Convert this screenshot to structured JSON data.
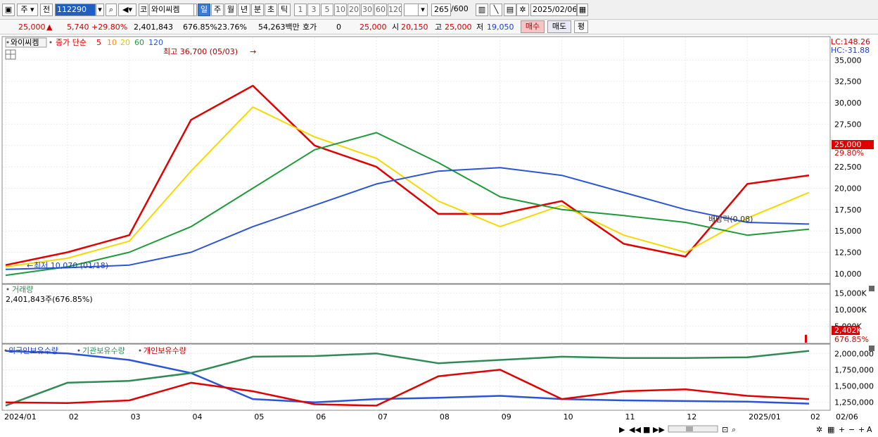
{
  "toolbar": {
    "market_combo": "주",
    "prev_label": "전",
    "code": "112290",
    "name_prefix": "코",
    "stock_name": "와이씨켐",
    "periods": [
      "일",
      "주",
      "월",
      "년",
      "분",
      "초",
      "틱"
    ],
    "intervals": [
      "1",
      "3",
      "5",
      "10",
      "20",
      "30",
      "60",
      "120"
    ],
    "count": "265",
    "count_max": "/600",
    "date": "2025/02/06"
  },
  "quote": {
    "price": "25,000",
    "change": "5,740",
    "change_pct": "+29.80%",
    "volume": "2,401,843",
    "volume_ratio": "676.85%",
    "turnover": "23.76%",
    "amount": "54,263백만",
    "hoga_label": "호가",
    "hoga_value": "0",
    "hoga_price": "25,000",
    "open_label": "시",
    "open": "20,150",
    "high_label": "고",
    "high": "25,000",
    "low_label": "저",
    "low": "19,050",
    "buy_button": "매수",
    "sell_button": "매도",
    "eval_button": "평"
  },
  "price_panel": {
    "stock_tag": "와이씨켐",
    "legend_main": "종가 단순",
    "ma_labels": [
      "5",
      "10",
      "20",
      "60",
      "120"
    ],
    "ma_colors": [
      "#e00000",
      "#ff8c1a",
      "#f5d800",
      "#1f9a3a",
      "#2b55d6"
    ],
    "lc": "LC:148.26",
    "hc": "HC:-31.88",
    "high_annotation": "최고 36,700 (05/03)",
    "low_annotation": "최저 10,070 (01/18)",
    "dividend_annotation": "배당락(0.08)",
    "current_price_tag": "25,000",
    "current_change_tag": "29.80%",
    "y_ticks": [
      "35,000",
      "32,500",
      "30,000",
      "27,500",
      "25,000",
      "22,500",
      "20,000",
      "17,500",
      "15,000",
      "12,500",
      "10,000"
    ]
  },
  "volume_panel": {
    "title": "거래량",
    "value": "2,401,843주(676.85%)",
    "y_ticks": [
      "15,000K",
      "10,000K",
      "5,000K"
    ],
    "current_tag": "2,402K",
    "current_pct": "676.85%"
  },
  "holdings_panel": {
    "series_names": [
      "외국인보유수량",
      "기관보유수량",
      "개인보유수량"
    ],
    "colors": [
      "#2b55d6",
      "#2f8a55",
      "#e00000"
    ],
    "y_ticks": [
      "2,000,000",
      "1,750,000",
      "1,500,000",
      "1,250,000"
    ]
  },
  "x_axis": [
    "2024/01",
    "02",
    "03",
    "04",
    "05",
    "06",
    "07",
    "08",
    "09",
    "10",
    "11",
    "12",
    "2025/01",
    "02",
    "02/06"
  ],
  "chart_data": [
    {
      "type": "line",
      "title": "",
      "xlabel": "",
      "ylabel": "",
      "ylim": [
        9000,
        37500
      ],
      "x": [
        "2024/01",
        "02",
        "03",
        "04",
        "05",
        "06",
        "07",
        "08",
        "09",
        "10",
        "11",
        "12",
        "2025/01",
        "02"
      ],
      "series": [
        {
          "name": "5",
          "values": [
            11000,
            12500,
            14500,
            28000,
            32000,
            25000,
            22500,
            17000,
            17000,
            18500,
            13500,
            12000,
            20500,
            21500
          ]
        },
        {
          "name": "20",
          "values": [
            10800,
            11800,
            13800,
            22000,
            29500,
            26000,
            23500,
            18500,
            15500,
            18000,
            14500,
            12500,
            16500,
            19500
          ]
        },
        {
          "name": "60",
          "values": [
            9800,
            10800,
            12500,
            15500,
            20000,
            24500,
            26500,
            23000,
            19000,
            17500,
            16800,
            16000,
            14500,
            15200
          ]
        },
        {
          "name": "120",
          "values": [
            10500,
            10700,
            11000,
            12500,
            15500,
            18000,
            20500,
            22000,
            22400,
            21500,
            19500,
            17500,
            16000,
            15800
          ]
        }
      ]
    },
    {
      "type": "bar",
      "title": "거래량",
      "ylim": [
        0,
        17000
      ],
      "y_unit": "K",
      "current_value": 2402
    },
    {
      "type": "line",
      "title": "",
      "ylim": [
        1150000,
        2100000
      ],
      "x": [
        "2024/01",
        "02",
        "03",
        "04",
        "05",
        "06",
        "07",
        "08",
        "09",
        "10",
        "11",
        "12",
        "2025/01",
        "02"
      ],
      "series": [
        {
          "name": "외국인보유수량",
          "values": [
            2040000,
            2000000,
            1900000,
            1700000,
            1300000,
            1250000,
            1300000,
            1320000,
            1350000,
            1300000,
            1280000,
            1270000,
            1260000,
            1230000
          ]
        },
        {
          "name": "기관보유수량",
          "values": [
            1200000,
            1550000,
            1580000,
            1700000,
            1950000,
            1960000,
            2000000,
            1850000,
            1900000,
            1950000,
            1930000,
            1930000,
            1940000,
            2040000
          ]
        },
        {
          "name": "개인보유수량",
          "values": [
            1250000,
            1240000,
            1280000,
            1550000,
            1420000,
            1220000,
            1200000,
            1650000,
            1750000,
            1300000,
            1420000,
            1450000,
            1350000,
            1300000
          ]
        }
      ]
    }
  ]
}
